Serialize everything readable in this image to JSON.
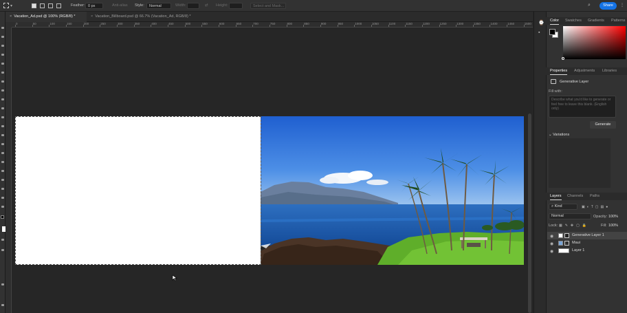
{
  "options_bar": {
    "feather_label": "Feather:",
    "feather_value": "0 px",
    "antialias_label": "Anti-alias",
    "style_label": "Style:",
    "style_value": "Normal",
    "width_label": "Width:",
    "height_label": "Height:",
    "select_mask_label": "Select and Mask...",
    "share_label": "Share"
  },
  "tabs": [
    {
      "label": "Vacation_Ad.psd @ 100% (RGB/8) *",
      "active": true
    },
    {
      "label": "Vacation_Billboard.psd @ 66.7% (Vacation_Ad, RGB/8) *",
      "active": false
    }
  ],
  "ruler_labels": [
    "0",
    "50",
    "100",
    "150",
    "200",
    "250",
    "300",
    "350",
    "400",
    "450",
    "500",
    "550",
    "600",
    "650",
    "700",
    "750",
    "800",
    "850",
    "900",
    "950",
    "1000",
    "1050",
    "1100",
    "1150",
    "1200",
    "1250",
    "1300",
    "1350",
    "1400",
    "1450",
    "1500"
  ],
  "color_panel": {
    "tabs": [
      "Color",
      "Swatches",
      "Gradients",
      "Patterns"
    ],
    "colors": {
      "foreground": "#000000",
      "background": "#ffffff",
      "hue": "#ff0000"
    }
  },
  "properties_panel": {
    "tabs": [
      "Properties",
      "Adjustments",
      "Libraries"
    ],
    "layer_type": "Generative Layer",
    "fill_with_label": "Fill with:",
    "prompt_placeholder": "Describe what you'd like to generate or feel free to leave this blank. (English only)",
    "generate_label": "Generate",
    "variations_label": "Variations"
  },
  "layers_panel": {
    "tabs": [
      "Layers",
      "Channels",
      "Paths"
    ],
    "filter_value": "Kind",
    "blend_mode": "Normal",
    "opacity_label": "Opacity:",
    "opacity_value": "100%",
    "lock_label": "Lock:",
    "fill_label": "Fill:",
    "fill_value": "100%",
    "layers": [
      {
        "name": "Generative Layer 1",
        "selected": true
      },
      {
        "name": "Maui",
        "selected": false
      },
      {
        "name": "Layer 1",
        "selected": false
      }
    ]
  }
}
